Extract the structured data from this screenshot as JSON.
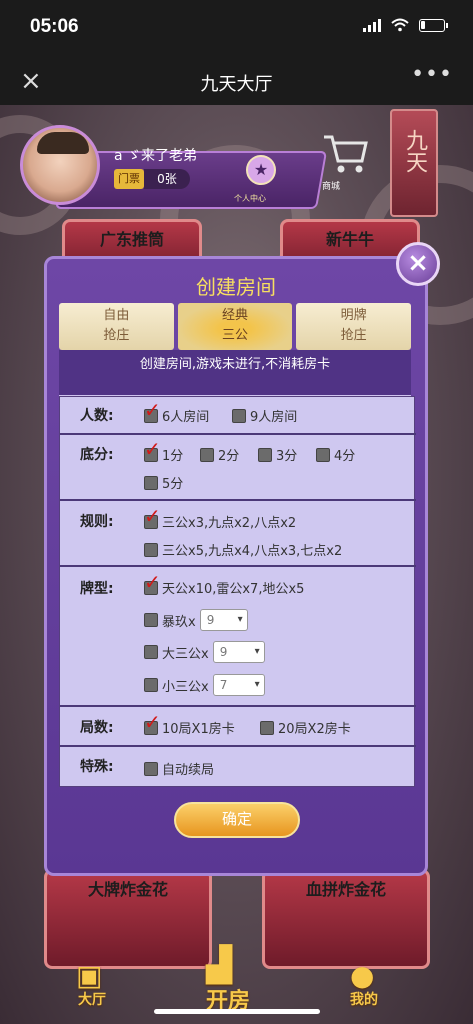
{
  "status": {
    "time": "05:06"
  },
  "nav": {
    "title": "九天大厅",
    "close_icon": "×",
    "more_icon": "•••"
  },
  "profile": {
    "name": "a ゞ来了老弟",
    "card_label": "门票",
    "card_count": "0张",
    "star_label": "个人中心",
    "shop_label": "商城",
    "banner_text": "九天"
  },
  "games": {
    "top_left": "广东推筒",
    "top_right": "新牛牛",
    "bottom_left": "大牌炸金花",
    "bottom_right": "血拼炸金花"
  },
  "bottom_nav": {
    "left": "大厅",
    "center": "开房",
    "right": "我的"
  },
  "dialog": {
    "title": "创建房间",
    "tabs": [
      {
        "line1": "自由",
        "line2": "抢庄"
      },
      {
        "line1": "经典",
        "line2": "三公"
      },
      {
        "line1": "明牌",
        "line2": "抢庄"
      }
    ],
    "notice": "创建房间,游戏未进行,不消耗房卡",
    "rows": {
      "players": {
        "label": "人数:",
        "opt1": "6人房间",
        "opt2": "9人房间"
      },
      "base": {
        "label": "底分:",
        "opt1": "1分",
        "opt2": "2分",
        "opt3": "3分",
        "opt4": "4分",
        "opt5": "5分"
      },
      "rules": {
        "label": "规则:",
        "opt1": "三公x3,九点x2,八点x2",
        "opt2": "三公x5,九点x4,八点x3,七点x2"
      },
      "cards": {
        "label": "牌型:",
        "opt1": "天公x10,雷公x7,地公x5",
        "opt2": "暴玖x",
        "opt2_sel": "9",
        "opt3": "大三公x",
        "opt3_sel": "9",
        "opt4": "小三公x",
        "opt4_sel": "7"
      },
      "rounds": {
        "label": "局数:",
        "opt1": "10局X1房卡",
        "opt2": "20局X2房卡"
      },
      "special": {
        "label": "特殊:",
        "opt1": "自动续局"
      }
    },
    "confirm": "确定"
  }
}
